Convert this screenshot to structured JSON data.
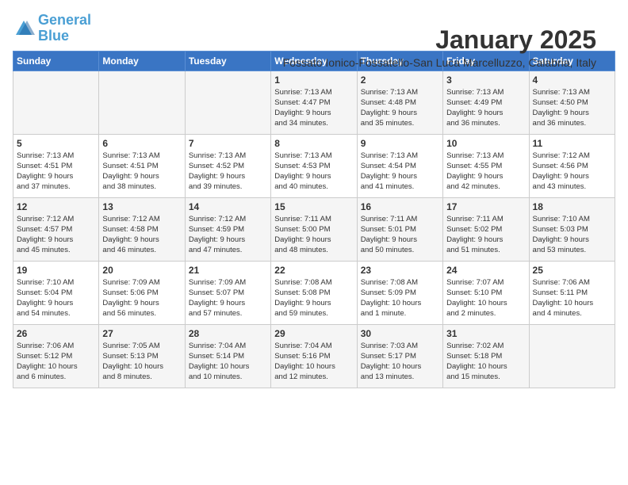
{
  "header": {
    "logo_line1": "General",
    "logo_line2": "Blue",
    "month": "January 2025",
    "location": "Fossato Ionico-Fossatello-San Luca Marcelluzzo, Calabria, Italy"
  },
  "days_of_week": [
    "Sunday",
    "Monday",
    "Tuesday",
    "Wednesday",
    "Thursday",
    "Friday",
    "Saturday"
  ],
  "weeks": [
    [
      {
        "num": "",
        "info": ""
      },
      {
        "num": "",
        "info": ""
      },
      {
        "num": "",
        "info": ""
      },
      {
        "num": "1",
        "info": "Sunrise: 7:13 AM\nSunset: 4:47 PM\nDaylight: 9 hours\nand 34 minutes."
      },
      {
        "num": "2",
        "info": "Sunrise: 7:13 AM\nSunset: 4:48 PM\nDaylight: 9 hours\nand 35 minutes."
      },
      {
        "num": "3",
        "info": "Sunrise: 7:13 AM\nSunset: 4:49 PM\nDaylight: 9 hours\nand 36 minutes."
      },
      {
        "num": "4",
        "info": "Sunrise: 7:13 AM\nSunset: 4:50 PM\nDaylight: 9 hours\nand 36 minutes."
      }
    ],
    [
      {
        "num": "5",
        "info": "Sunrise: 7:13 AM\nSunset: 4:51 PM\nDaylight: 9 hours\nand 37 minutes."
      },
      {
        "num": "6",
        "info": "Sunrise: 7:13 AM\nSunset: 4:51 PM\nDaylight: 9 hours\nand 38 minutes."
      },
      {
        "num": "7",
        "info": "Sunrise: 7:13 AM\nSunset: 4:52 PM\nDaylight: 9 hours\nand 39 minutes."
      },
      {
        "num": "8",
        "info": "Sunrise: 7:13 AM\nSunset: 4:53 PM\nDaylight: 9 hours\nand 40 minutes."
      },
      {
        "num": "9",
        "info": "Sunrise: 7:13 AM\nSunset: 4:54 PM\nDaylight: 9 hours\nand 41 minutes."
      },
      {
        "num": "10",
        "info": "Sunrise: 7:13 AM\nSunset: 4:55 PM\nDaylight: 9 hours\nand 42 minutes."
      },
      {
        "num": "11",
        "info": "Sunrise: 7:12 AM\nSunset: 4:56 PM\nDaylight: 9 hours\nand 43 minutes."
      }
    ],
    [
      {
        "num": "12",
        "info": "Sunrise: 7:12 AM\nSunset: 4:57 PM\nDaylight: 9 hours\nand 45 minutes."
      },
      {
        "num": "13",
        "info": "Sunrise: 7:12 AM\nSunset: 4:58 PM\nDaylight: 9 hours\nand 46 minutes."
      },
      {
        "num": "14",
        "info": "Sunrise: 7:12 AM\nSunset: 4:59 PM\nDaylight: 9 hours\nand 47 minutes."
      },
      {
        "num": "15",
        "info": "Sunrise: 7:11 AM\nSunset: 5:00 PM\nDaylight: 9 hours\nand 48 minutes."
      },
      {
        "num": "16",
        "info": "Sunrise: 7:11 AM\nSunset: 5:01 PM\nDaylight: 9 hours\nand 50 minutes."
      },
      {
        "num": "17",
        "info": "Sunrise: 7:11 AM\nSunset: 5:02 PM\nDaylight: 9 hours\nand 51 minutes."
      },
      {
        "num": "18",
        "info": "Sunrise: 7:10 AM\nSunset: 5:03 PM\nDaylight: 9 hours\nand 53 minutes."
      }
    ],
    [
      {
        "num": "19",
        "info": "Sunrise: 7:10 AM\nSunset: 5:04 PM\nDaylight: 9 hours\nand 54 minutes."
      },
      {
        "num": "20",
        "info": "Sunrise: 7:09 AM\nSunset: 5:06 PM\nDaylight: 9 hours\nand 56 minutes."
      },
      {
        "num": "21",
        "info": "Sunrise: 7:09 AM\nSunset: 5:07 PM\nDaylight: 9 hours\nand 57 minutes."
      },
      {
        "num": "22",
        "info": "Sunrise: 7:08 AM\nSunset: 5:08 PM\nDaylight: 9 hours\nand 59 minutes."
      },
      {
        "num": "23",
        "info": "Sunrise: 7:08 AM\nSunset: 5:09 PM\nDaylight: 10 hours\nand 1 minute."
      },
      {
        "num": "24",
        "info": "Sunrise: 7:07 AM\nSunset: 5:10 PM\nDaylight: 10 hours\nand 2 minutes."
      },
      {
        "num": "25",
        "info": "Sunrise: 7:06 AM\nSunset: 5:11 PM\nDaylight: 10 hours\nand 4 minutes."
      }
    ],
    [
      {
        "num": "26",
        "info": "Sunrise: 7:06 AM\nSunset: 5:12 PM\nDaylight: 10 hours\nand 6 minutes."
      },
      {
        "num": "27",
        "info": "Sunrise: 7:05 AM\nSunset: 5:13 PM\nDaylight: 10 hours\nand 8 minutes."
      },
      {
        "num": "28",
        "info": "Sunrise: 7:04 AM\nSunset: 5:14 PM\nDaylight: 10 hours\nand 10 minutes."
      },
      {
        "num": "29",
        "info": "Sunrise: 7:04 AM\nSunset: 5:16 PM\nDaylight: 10 hours\nand 12 minutes."
      },
      {
        "num": "30",
        "info": "Sunrise: 7:03 AM\nSunset: 5:17 PM\nDaylight: 10 hours\nand 13 minutes."
      },
      {
        "num": "31",
        "info": "Sunrise: 7:02 AM\nSunset: 5:18 PM\nDaylight: 10 hours\nand 15 minutes."
      },
      {
        "num": "",
        "info": ""
      }
    ]
  ]
}
